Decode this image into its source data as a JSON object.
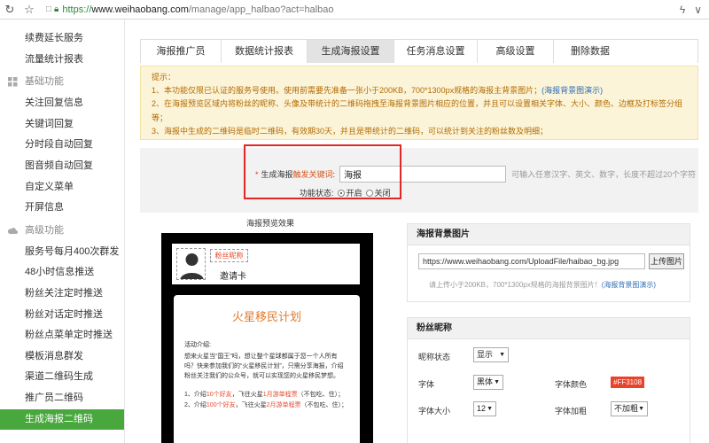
{
  "browser": {
    "url_https": "https://",
    "url_host": "www.weihaobang.com",
    "url_path": "/manage/app_halbao?act=halbao"
  },
  "sidebar": {
    "items_top": [
      "续费延长服务",
      "流量统计报表"
    ],
    "group_basic": "基础功能",
    "items_basic": [
      "关注回复信息",
      "关键词回复",
      "分时段自动回复",
      "图音频自动回复",
      "自定义菜单",
      "开屏信息"
    ],
    "group_advanced": "高级功能",
    "items_advanced": [
      "服务号每月400次群发",
      "48小时信息推送",
      "粉丝关注定时推送",
      "粉丝对话定时推送",
      "粉丝点菜单定时推送",
      "模板消息群发",
      "渠道二维码生成",
      "推广员二维码",
      "生成海报二维码"
    ]
  },
  "tabs": [
    "海报推广员",
    "数据统计报表",
    "生成海报设置",
    "任务消息设置",
    "高级设置",
    "删除数据"
  ],
  "tips": {
    "title": "提示：",
    "line1": "1、本功能仅限已认证的服务号使用。使用前需要先准备一张小于200KB，700*1300px规格的海报主背景图片；",
    "line1_link": "(海报背景图演示)",
    "line2": "2、在海报预览区域内将粉丝的昵称、头像及带统计的二维码拖拽至海报背景图片相应的位置，并且可以设置相关字体、大小、颜色、边框及打标签分组等；",
    "line3": "3、海报中生成的二维码是临时二维码，有效期30天，并且是带统计的二维码，可以统计到关注的粉丝数及明细；"
  },
  "form": {
    "required_mark": "*",
    "keyword_label_a": "生成海报",
    "keyword_label_b": "触发关键词",
    "keyword_colon": ":",
    "keyword_value": "海报",
    "keyword_hint": "可输入任意汉字、英文、数字，长度不超过20个字符",
    "status_label": "功能状态:",
    "status_on": "开启",
    "status_off": "关闭"
  },
  "preview": {
    "label": "海报预览效果",
    "nickname_placeholder": "粉丝昵称",
    "invite_text": "邀请卡",
    "poster_title": "火星移民计划",
    "activity_heading": "活动介绍:",
    "activity_body": "想来火星当“国王”吗，想让整个星球都属于您一个人所有吗？快来参加我们的“火星移民计划”，只需分享海报，介绍粉丝关注我们的公众号，就可以实现您的火星移民梦想。",
    "list1_a": "1、介绍",
    "list1_b": "10个好友",
    "list1_c": "，飞往火星",
    "list1_d": "1月游单程票",
    "list1_e": "（不包吃、住）；",
    "list2_a": "2、介绍",
    "list2_b": "100个好友",
    "list2_c": "，飞往火星",
    "list2_d": "2月游单程票",
    "list2_e": "（不包吃、住）；"
  },
  "bg_panel": {
    "title": "海报背景图片",
    "url_value": "https://www.weihaobang.com/UploadFile/haibao_bg.jpg",
    "upload_label": "上传图片",
    "hint": "请上传小于200KB，700*1300px规格的海报背景图片！",
    "hint_link": "(海报背景图演示)"
  },
  "nick_panel": {
    "title": "粉丝昵称",
    "status_label": "昵称状态",
    "status_value": "显示",
    "font_label": "字体",
    "font_value": "黑体",
    "color_label": "字体颜色",
    "color_value": "#FF3108",
    "size_label": "字体大小",
    "size_value": "12",
    "bold_label": "字体加粗",
    "bold_value": "不加粗"
  }
}
